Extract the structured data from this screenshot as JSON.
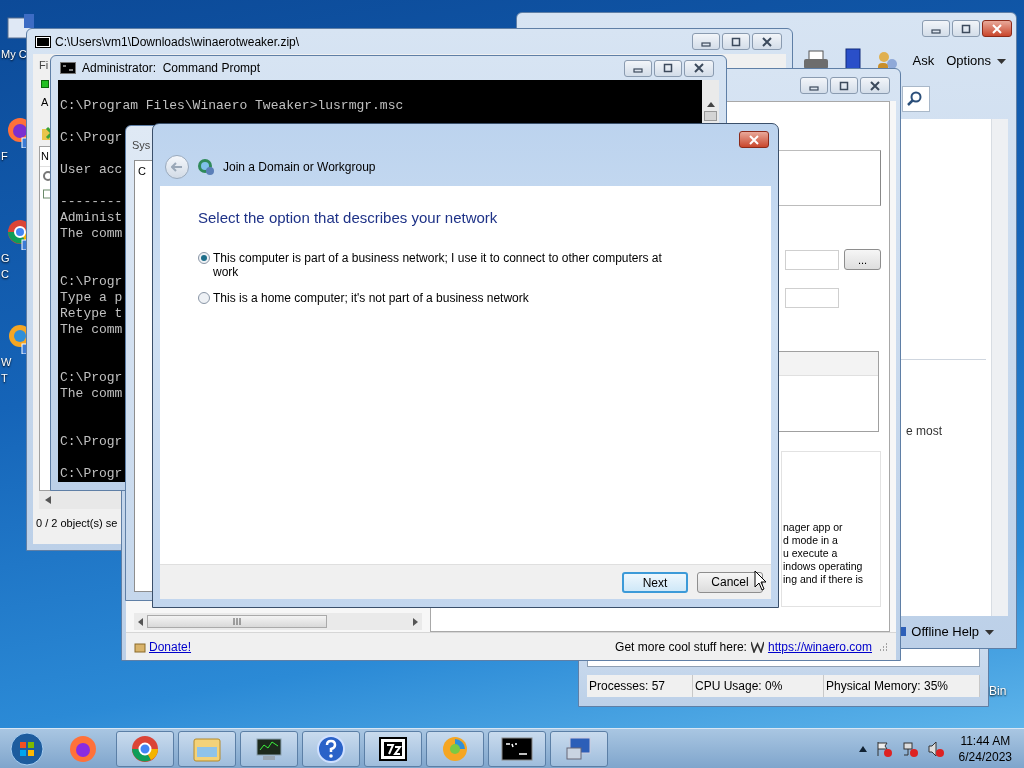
{
  "desktop": {
    "icons": [
      {
        "kind": "computer",
        "label_lines": [
          "My C"
        ]
      },
      {
        "kind": "firefox",
        "label_lines": [
          "F"
        ]
      },
      {
        "kind": "chrome",
        "label_lines": [
          "G",
          "C"
        ]
      },
      {
        "kind": "tweaker",
        "label_lines": [
          "W",
          "T"
        ]
      }
    ],
    "recycle_bin_label": "Bin"
  },
  "task_manager": {
    "status": [
      "Processes: 57",
      "CPU Usage: 0%",
      "Physical Memory: 35%"
    ]
  },
  "help_window": {
    "ask": "Ask",
    "options": "Options",
    "body_text": "e most",
    "footer": "Offline Help"
  },
  "archive_window": {
    "title": "C:\\Users\\vm1\\Downloads\\winaerotweaker.zip\\",
    "menu": "Fi",
    "toolbar_label": "A",
    "column": "N",
    "status": "0 / 2 object(s) se"
  },
  "console_window": {
    "title": "Administrator:  Command Prompt",
    "output": "C:\\Program Files\\Winaero Tweaker>lusrmgr.msc\n\nC:\\Progr\n\nUser acc\n\n--------\nAdminist\nThe comm\n\n\nC:\\Progr\nType a p\nRetype t\nThe comm\n\n\nC:\\Progr\nThe comm\n\n\nC:\\Progr\n\nC:\\Progr"
  },
  "system_window": {
    "title": "Sys",
    "tab": "C"
  },
  "tweaker_window": {
    "browse_button": "...",
    "description": [
      "nager app or",
      "d mode in a",
      "u execute a",
      "indows operating",
      "ing and if there is"
    ],
    "donate": "Donate!",
    "promo": "Get more cool stuff here:",
    "link": "https://winaero.com"
  },
  "dialog": {
    "title": "Join a Domain or Workgroup",
    "heading": "Select the option that describes your network",
    "options": [
      {
        "label": "This computer is part of a business network; I use it to connect to other computers at work",
        "selected": true
      },
      {
        "label": "This is a home computer; it's not part of a business network",
        "selected": false
      }
    ],
    "buttons": [
      {
        "label": "Next",
        "default": true
      },
      {
        "label": "Cancel",
        "default": false
      }
    ]
  },
  "taskbar": {
    "items": [
      {
        "kind": "firefox",
        "running": false
      },
      {
        "kind": "chrome",
        "running": true
      },
      {
        "kind": "explorer",
        "running": true
      },
      {
        "kind": "monitor",
        "running": true
      },
      {
        "kind": "help",
        "running": true
      },
      {
        "kind": "archiver",
        "running": true
      },
      {
        "kind": "tweaker",
        "running": true
      },
      {
        "kind": "console",
        "running": true
      },
      {
        "kind": "remote",
        "running": true
      }
    ],
    "time": "11:44 AM",
    "date": "6/24/2023"
  }
}
